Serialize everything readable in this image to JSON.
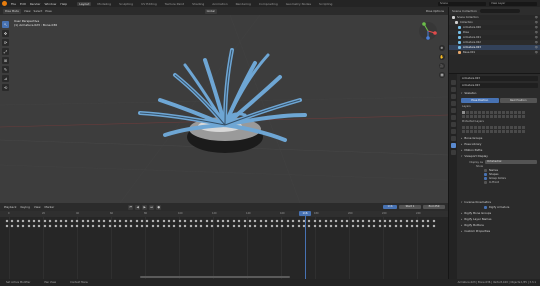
{
  "topbar": {
    "menus": [
      "File",
      "Edit",
      "Render",
      "Window",
      "Help"
    ],
    "workspaces": [
      "Layout",
      "Modeling",
      "Sculpting",
      "UV Editing",
      "Texture Paint",
      "Shading",
      "Animation",
      "Rendering",
      "Compositing",
      "Geometry Nodes",
      "Scripting"
    ],
    "active_workspace": "Layout",
    "scene": "Scene",
    "view_layer": "View Layer"
  },
  "viewport_header": {
    "mode": "Pose Mode",
    "view": "View",
    "select": "Select",
    "pose": "Pose",
    "orientation": "Global",
    "options": "Pose Options"
  },
  "viewport": {
    "view_name": "User Perspective",
    "active_info": "(1) Armature.023 : Bone.036"
  },
  "left_tools": [
    "↖",
    "✥",
    "⟳",
    "⤢",
    "⊞",
    "✎",
    "⊿",
    "⟲"
  ],
  "nav_buttons": [
    "⊕",
    "✋",
    "🎥",
    "▦"
  ],
  "timeline": {
    "menus": [
      "Playback",
      "Keying",
      "View",
      "Marker"
    ],
    "controls": [
      "⏮",
      "◀",
      "▶",
      "⏭",
      "●"
    ],
    "fields": {
      "current_frame": "116",
      "start": "Start  1",
      "end": "End  250"
    },
    "ticks": [
      "0",
      "20",
      "40",
      "60",
      "80",
      "100",
      "120",
      "140",
      "160",
      "180",
      "200",
      "220",
      "240"
    ],
    "playhead_label": "116"
  },
  "status": {
    "items": [
      "Set Active Modifier",
      "Pan View",
      "Context Menu"
    ],
    "right": "Armature.023 | Bone.036 | Verts:8,160 | Objects:1/55 | 3.3.1"
  },
  "outliner": {
    "title": "Scene Collection",
    "items": [
      {
        "label": "Scene Collection",
        "color": "#cfcfcf",
        "selected": false
      },
      {
        "label": "Collection",
        "color": "#cfcfcf",
        "selected": false
      },
      {
        "label": "Armature.020",
        "color": "#75bde6",
        "selected": false
      },
      {
        "label": "Pose",
        "color": "#75bde6",
        "selected": false
      },
      {
        "label": "Armature.021",
        "color": "#75bde6",
        "selected": false
      },
      {
        "label": "Armature.022",
        "color": "#75bde6",
        "selected": false
      },
      {
        "label": "Armature.023",
        "color": "#75bde6",
        "selected": true
      },
      {
        "label": "Base.001",
        "color": "#e8a86b",
        "selected": false
      }
    ]
  },
  "properties": {
    "object_name": "Armature.023",
    "data_name": "Armature.023",
    "sections": {
      "skeleton": "Skeleton",
      "pose_position": "Pose Position",
      "rest_position": "Rest Position",
      "layers": "Layers",
      "protected_layers": "Protected Layers",
      "bone_groups": "Bone Groups",
      "pose_library": "Pose Library",
      "motion_paths": "Motion Paths",
      "viewport_display": "Viewport Display",
      "inverse_kinematics": "Inverse Kinematics",
      "rigify_bone_groups": "Rigify Bone Groups",
      "rigify_layer_names": "Rigify Layer Names",
      "rigify_buttons": "Rigify Buttons",
      "custom_properties": "Custom Properties"
    },
    "display_as_label": "Display As",
    "display_as_value": "Octahedral",
    "show_label": "Show",
    "show_options": [
      {
        "label": "Names",
        "on": false
      },
      {
        "label": "Shapes",
        "on": true
      },
      {
        "label": "Group Colors",
        "on": true
      },
      {
        "label": "In Front",
        "on": false
      }
    ],
    "ik_enabled": "Rigify Armature"
  }
}
